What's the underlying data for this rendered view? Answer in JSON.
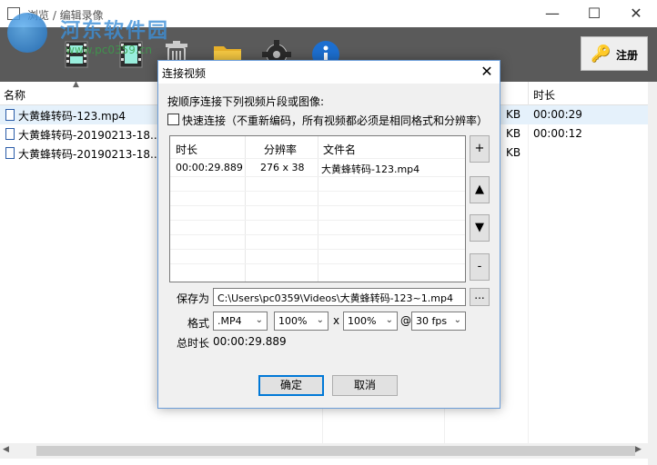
{
  "main_window": {
    "title": "浏览 / 编辑录像",
    "min_glyph": "—",
    "max_glyph": "☐",
    "close_glyph": "✕"
  },
  "watermark": {
    "text": "河东软件园",
    "url": "www.pc0359.cn"
  },
  "toolbar": {
    "register_label": "注册"
  },
  "list": {
    "columns": {
      "name": "名称",
      "duration": "时长"
    },
    "rows": [
      {
        "name": "大黄蜂转码-123.mp4",
        "size": "KB",
        "duration": "00:00:29"
      },
      {
        "name": "大黄蜂转码-20190213-18...",
        "size": "KB",
        "duration": "00:00:12"
      },
      {
        "name": "大黄蜂转码-20190213-18...",
        "size": "KB",
        "duration": ""
      }
    ]
  },
  "dialog": {
    "title": "连接视频",
    "instruction": "按顺序连接下列视频片段或图像:",
    "fast_connect_label": "快速连接（不重新编码，所有视频都必须是相同格式和分辨率）",
    "table": {
      "columns": {
        "duration": "时长",
        "resolution": "分辨率",
        "filename": "文件名"
      },
      "rows": [
        {
          "duration": "00:00:29.889",
          "resolution": "276 x 38",
          "filename": "大黄蜂转码-123.mp4"
        }
      ]
    },
    "side_buttons": {
      "add": "+",
      "up": "▲",
      "down": "▼",
      "remove": "-"
    },
    "save_as_label": "保存为",
    "save_path": "C:\\Users\\pc0359\\Videos\\大黄蜂转码-123~1.mp4",
    "browse_label": "...",
    "format_label": "格式",
    "format_value": ".MP4",
    "width_scale": "100%",
    "x_sep": "x",
    "height_scale": "100%",
    "at_sep": "@",
    "fps": "30 fps",
    "total_label": "总时长",
    "total_value": "00:00:29.889",
    "ok_label": "确定",
    "cancel_label": "取消"
  },
  "colors": {
    "toolbar_bg": "#5a5a5a",
    "selection": "#e5f1fb",
    "dialog_border": "#6d9ed8",
    "focus_blue": "#0078d7"
  }
}
